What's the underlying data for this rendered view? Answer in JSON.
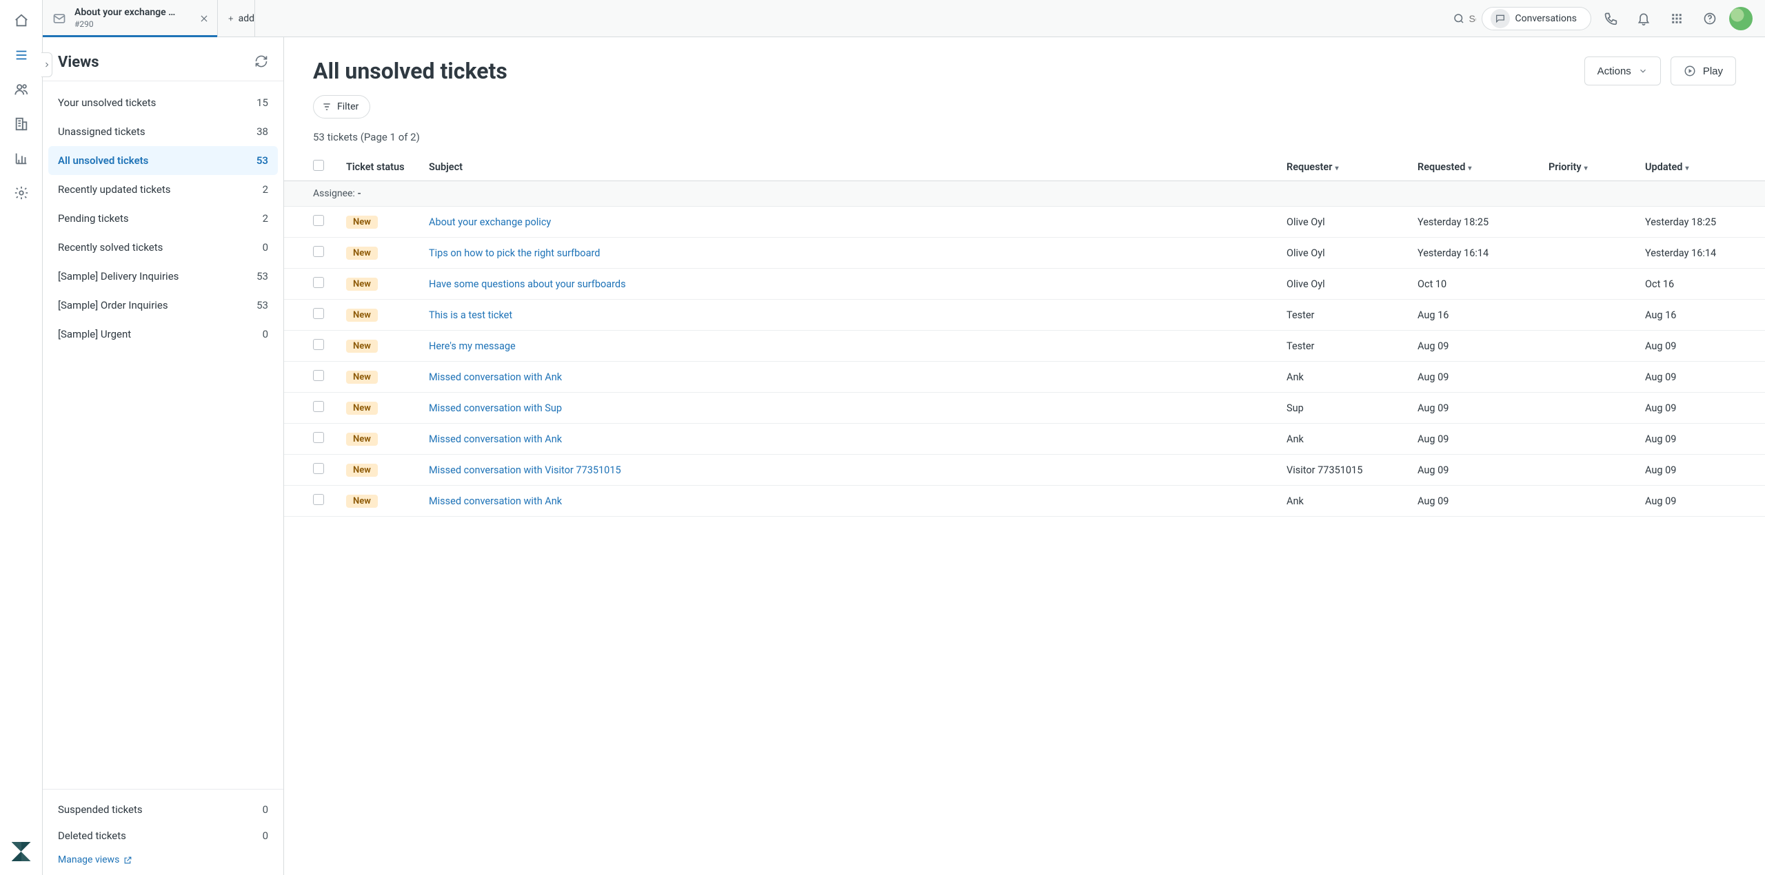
{
  "colors": {
    "accent": "#1f73b7",
    "badge_bg": "#ffeccc",
    "badge_fg": "#8a5600"
  },
  "tab": {
    "title": "About your exchange …",
    "sub": "#290",
    "add_label": "add"
  },
  "topbar": {
    "search_placeholder": "Search",
    "conversations_label": "Conversations"
  },
  "sidebar": {
    "title": "Views",
    "manage_label": "Manage views",
    "items": [
      {
        "label": "Your unsolved tickets",
        "count": "15"
      },
      {
        "label": "Unassigned tickets",
        "count": "38"
      },
      {
        "label": "All unsolved tickets",
        "count": "53",
        "active": true
      },
      {
        "label": "Recently updated tickets",
        "count": "2"
      },
      {
        "label": "Pending tickets",
        "count": "2"
      },
      {
        "label": "Recently solved tickets",
        "count": "0"
      },
      {
        "label": "[Sample] Delivery Inquiries",
        "count": "53"
      },
      {
        "label": "[Sample] Order Inquiries",
        "count": "53"
      },
      {
        "label": "[Sample] Urgent",
        "count": "0"
      }
    ],
    "bottom": [
      {
        "label": "Suspended tickets",
        "count": "0"
      },
      {
        "label": "Deleted tickets",
        "count": "0"
      }
    ]
  },
  "content": {
    "page_title": "All unsolved tickets",
    "actions_label": "Actions",
    "play_label": "Play",
    "filter_label": "Filter",
    "result_count": "53 tickets (Page 1 of 2)",
    "assignee_label": "Assignee:",
    "assignee_value": "-",
    "columns": {
      "status": "Ticket status",
      "subject": "Subject",
      "requester": "Requester",
      "requested": "Requested",
      "priority": "Priority",
      "updated": "Updated"
    },
    "status_new": "New",
    "rows": [
      {
        "subject": "About your exchange policy",
        "requester": "Olive Oyl",
        "requested": "Yesterday 18:25",
        "updated": "Yesterday 18:25"
      },
      {
        "subject": "Tips on how to pick the right surfboard",
        "requester": "Olive Oyl",
        "requested": "Yesterday 16:14",
        "updated": "Yesterday 16:14"
      },
      {
        "subject": "Have some questions about your surfboards",
        "requester": "Olive Oyl",
        "requested": "Oct 10",
        "updated": "Oct 16"
      },
      {
        "subject": "This is a test ticket",
        "requester": "Tester",
        "requested": "Aug 16",
        "updated": "Aug 16"
      },
      {
        "subject": "Here's my message",
        "requester": "Tester",
        "requested": "Aug 09",
        "updated": "Aug 09"
      },
      {
        "subject": "Missed conversation with Ank",
        "requester": "Ank",
        "requested": "Aug 09",
        "updated": "Aug 09"
      },
      {
        "subject": "Missed conversation with Sup",
        "requester": "Sup",
        "requested": "Aug 09",
        "updated": "Aug 09"
      },
      {
        "subject": "Missed conversation with Ank",
        "requester": "Ank",
        "requested": "Aug 09",
        "updated": "Aug 09"
      },
      {
        "subject": "Missed conversation with Visitor 77351015",
        "requester": "Visitor 77351015",
        "requested": "Aug 09",
        "updated": "Aug 09"
      },
      {
        "subject": "Missed conversation with Ank",
        "requester": "Ank",
        "requested": "Aug 09",
        "updated": "Aug 09"
      }
    ]
  }
}
